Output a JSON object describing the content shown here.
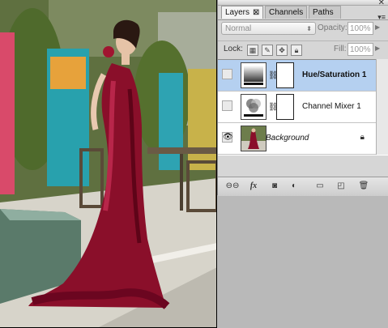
{
  "panel": {
    "close_glyph": "✕",
    "menu_glyph": "▾≡",
    "tabs": [
      {
        "label": "Layers",
        "active": true,
        "close": "⊠"
      },
      {
        "label": "Channels",
        "active": false
      },
      {
        "label": "Paths",
        "active": false
      }
    ],
    "blend_mode": "Normal",
    "opacity_label": "Opacity:",
    "opacity_value": "100%",
    "lock_label": "Lock:",
    "fill_label": "Fill:",
    "fill_value": "100%",
    "layers": [
      {
        "name": "Hue/Saturation 1",
        "selected": true,
        "visible": false,
        "icon": "hue-saturation-adjustment-icon"
      },
      {
        "name": "Channel Mixer 1",
        "selected": false,
        "visible": false,
        "icon": "channel-mixer-adjustment-icon"
      },
      {
        "name": "Background",
        "selected": false,
        "visible": true,
        "locked": true,
        "icon": "photo-thumbnail"
      }
    ],
    "bottom_icons": [
      "link-layers-icon",
      "fx-icon",
      "add-mask-icon",
      "new-adjustment-icon",
      "new-group-icon",
      "new-layer-icon",
      "trash-icon"
    ],
    "accent": "#b5d0f0"
  }
}
